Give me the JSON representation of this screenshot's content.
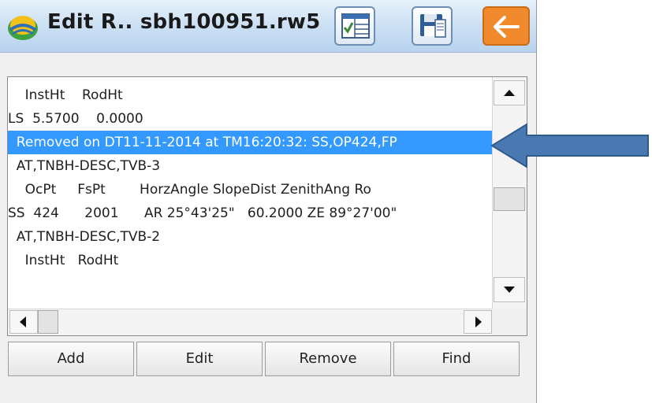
{
  "window": {
    "title": "Edit R.. sbh100951.rw5"
  },
  "toolbar": {
    "grid_icon": "data-grid-icon",
    "save_icon": "save-disk-icon",
    "back_icon": "back-arrow-icon",
    "back_color": "#f08a2c"
  },
  "list": {
    "rows": [
      "    InstHt    RodHt",
      "LS  5.5700    0.0000",
      "  Removed on DT11-11-2014 at TM16:20:32: SS,OP424,FP",
      "  AT,TNBH-DESC,TVB-3",
      "    OcPt     FsPt        HorzAngle SlopeDist ZenithAng Ro",
      "SS  424      2001      AR 25°43'25\"   60.2000 ZE 89°27'00\"",
      "  AT,TNBH-DESC,TVB-2",
      "    InstHt   RodHt"
    ],
    "selected_index": 2,
    "selection_color": "#3399ff"
  },
  "buttons": {
    "add": "Add",
    "edit": "Edit",
    "remove": "Remove",
    "find": "Find"
  },
  "annotation": {
    "arrow_color": "#4a78b0"
  }
}
